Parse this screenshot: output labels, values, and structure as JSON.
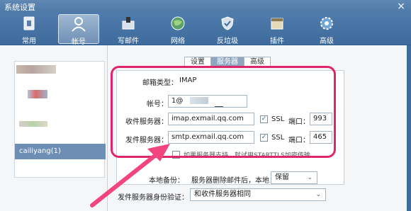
{
  "window": {
    "title": "系统设置",
    "close_glyph": "×"
  },
  "toolbar": {
    "items": [
      {
        "label": "常用",
        "icon": "general-icon"
      },
      {
        "label": "帐号",
        "icon": "account-icon"
      },
      {
        "label": "写邮件",
        "icon": "compose-icon"
      },
      {
        "label": "网络",
        "icon": "network-icon"
      },
      {
        "label": "反垃圾",
        "icon": "antispam-icon"
      },
      {
        "label": "插件",
        "icon": "plugin-icon"
      },
      {
        "label": "高级",
        "icon": "advanced-icon"
      }
    ],
    "active_index": 1
  },
  "accounts": {
    "selected": "cailiyang(1)"
  },
  "tabs": [
    {
      "label": "设置"
    },
    {
      "label": "服务器"
    },
    {
      "label": "高级"
    }
  ],
  "server": {
    "type_label": "邮箱类型：",
    "type_value": "IMAP",
    "account_label": "帐号：",
    "account_value": "1@",
    "incoming_label": "收件服务器：",
    "incoming_value": "imap.exmail.qq.com",
    "incoming_ssl_label": "SSL",
    "incoming_port_label": "端口：",
    "incoming_port": "993",
    "outgoing_label": "发件服务器：",
    "outgoing_value": "smtp.exmail.qq.com",
    "outgoing_ssl_label": "SSL",
    "outgoing_port_label": "端口：",
    "outgoing_port": "465",
    "starttls_hint": "如果服务器支持，就试用STARTTLS加密传输",
    "check_glyph": "✓"
  },
  "backup": {
    "label": "本地备份：",
    "text": "服务器删除邮件后，本地",
    "select_value": "保留"
  },
  "auth": {
    "label": "发件服务器身份验证：",
    "select_value": "和收件服务器相同"
  },
  "colors": {
    "highlight": "#e0266b",
    "arrow": "#f2457e",
    "toolbar": "#4f7cad"
  }
}
